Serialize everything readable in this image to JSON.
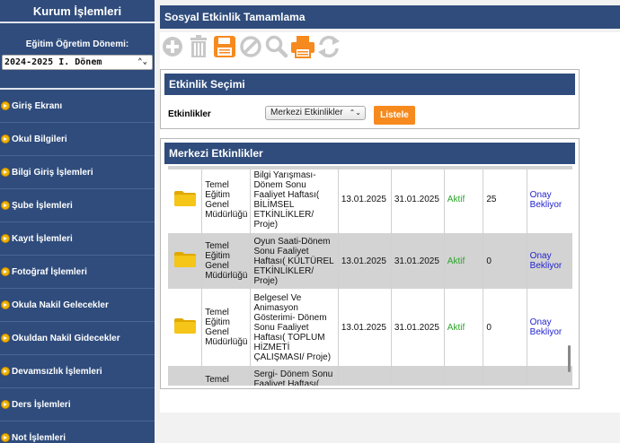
{
  "sidebar": {
    "title": "Kurum İşlemleri",
    "period_label": "Eğitim Öğretim Dönemi:",
    "period_value": "2024-2025 I. Dönem",
    "items": [
      {
        "label": "Giriş Ekranı"
      },
      {
        "label": "Okul Bilgileri"
      },
      {
        "label": "Bilgi Giriş İşlemleri"
      },
      {
        "label": "Şube İşlemleri"
      },
      {
        "label": "Kayıt İşlemleri"
      },
      {
        "label": "Fotoğraf İşlemleri"
      },
      {
        "label": "Okula Nakil Gelecekler"
      },
      {
        "label": "Okuldan Nakil Gidecekler"
      },
      {
        "label": "Devamsızlık İşlemleri"
      },
      {
        "label": "Ders İşlemleri"
      },
      {
        "label": "Not İşlemleri"
      }
    ]
  },
  "main": {
    "title": "Sosyal Etkinlik Tamamlama",
    "toolbar_icons": [
      "add-icon",
      "delete-icon",
      "save-icon",
      "cancel-icon",
      "search-icon",
      "print-icon",
      "refresh-icon"
    ]
  },
  "selection": {
    "title": "Etkinlik Seçimi",
    "label": "Etkinlikler",
    "dropdown_value": "Merkezi Etkinlikler",
    "list_button": "Listele"
  },
  "list": {
    "title": "Merkezi Etkinlikler",
    "rows": [
      {
        "institution": "Temel Eğitim Genel Müdürlüğü",
        "name": "Bilgi Yarışması-Dönem Sonu Faaliyet Haftası( BİLİMSEL ETKİNLİKLER/ Proje)",
        "start": "13.01.2025",
        "end": "31.01.2025",
        "status": "Aktif",
        "count": "25",
        "approval": "Onay Bekliyor"
      },
      {
        "institution": "Temel Eğitim Genel Müdürlüğü",
        "name": "Oyun Saati-Dönem Sonu Faaliyet Haftası( KÜLTÜREL ETKİNLİKLER/ Proje)",
        "start": "13.01.2025",
        "end": "31.01.2025",
        "status": "Aktif",
        "count": "0",
        "approval": "Onay Bekliyor"
      },
      {
        "institution": "Temel Eğitim Genel Müdürlüğü",
        "name": "Belgesel Ve Animasyon Gösterimi- Dönem Sonu Faaliyet Haftası( TOPLUM HİZMETİ ÇALIŞMASI/ Proje)",
        "start": "13.01.2025",
        "end": "31.01.2025",
        "status": "Aktif",
        "count": "0",
        "approval": "Onay Bekliyor"
      },
      {
        "institution": "Temel",
        "name": "Sergi- Dönem Sonu Faaliyet Haftası(",
        "start": "",
        "end": "",
        "status": "",
        "count": "",
        "approval": ""
      }
    ]
  },
  "colors": {
    "nav_blue": "#2f4c7c",
    "accent_orange": "#f68a1e",
    "status_green": "#2aa52a",
    "link_blue": "#1f1fd0",
    "folder_yellow": "#f5c518"
  }
}
